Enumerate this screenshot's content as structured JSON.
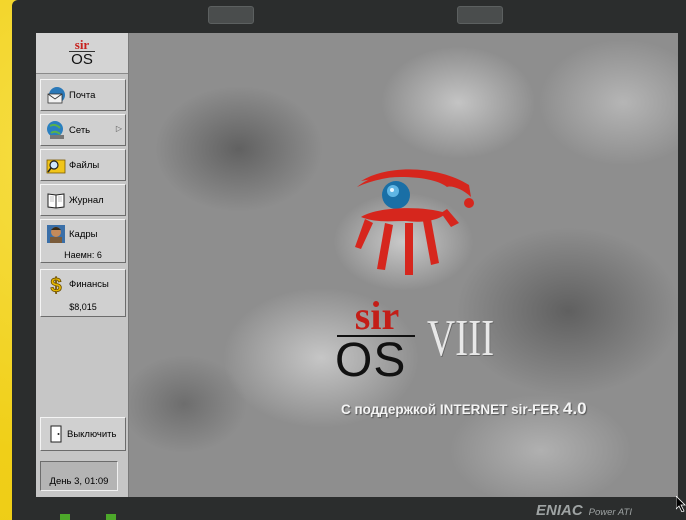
{
  "logo": {
    "sir": "sir",
    "os": "OS"
  },
  "sidebar": {
    "items": [
      {
        "label": "Почта"
      },
      {
        "label": "Сеть"
      },
      {
        "label": "Файлы"
      },
      {
        "label": "Журнал"
      },
      {
        "label": "Кадры",
        "sub": "Наемн: 6"
      },
      {
        "label": "Финансы",
        "sub": "$8,015"
      }
    ],
    "shutdown": "Выключить",
    "clock": "День  3,  01:09"
  },
  "splash": {
    "sir": "sir",
    "os": "OS",
    "version": "VIII",
    "tagline_prefix": "С поддержкой  INTERNET sir-FER",
    "tagline_version": "4.0"
  },
  "monitor": {
    "brand": "ENIAC",
    "model": "Power ATI"
  },
  "colors": {
    "brand_red": "#c31e18",
    "sidebar": "#c6c6c6",
    "frame": "#f2d21c"
  }
}
